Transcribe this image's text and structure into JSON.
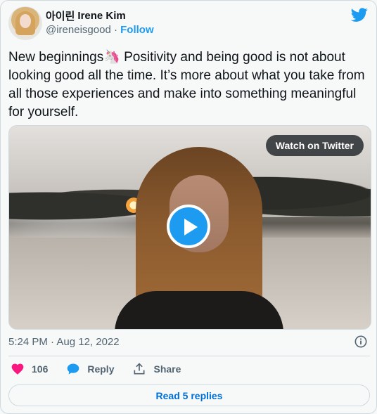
{
  "author": {
    "korean_name": "아이린",
    "name": "Irene Kim",
    "handle": "@ireneisgood",
    "separator": " · ",
    "follow_label": "Follow"
  },
  "tweet": {
    "text": "New beginnings🦄 Positivity and being good is not about looking good all the time. It’s more about what you take from all those experiences and make into something meaningful for yourself."
  },
  "media": {
    "watch_label": "Watch on Twitter",
    "play_icon": "play-icon"
  },
  "meta": {
    "timestamp": "5:24 PM · Aug 12, 2022",
    "info_icon": "info-icon"
  },
  "actions": {
    "like_count": "106",
    "reply_label": "Reply",
    "share_label": "Share"
  },
  "footer": {
    "read_replies_label": "Read 5 replies"
  },
  "colors": {
    "brand_blue": "#1d9bf0",
    "like_pink": "#f91880",
    "link_blue": "#006fd6",
    "muted_text": "#536471",
    "background": "#f7f9f9"
  }
}
